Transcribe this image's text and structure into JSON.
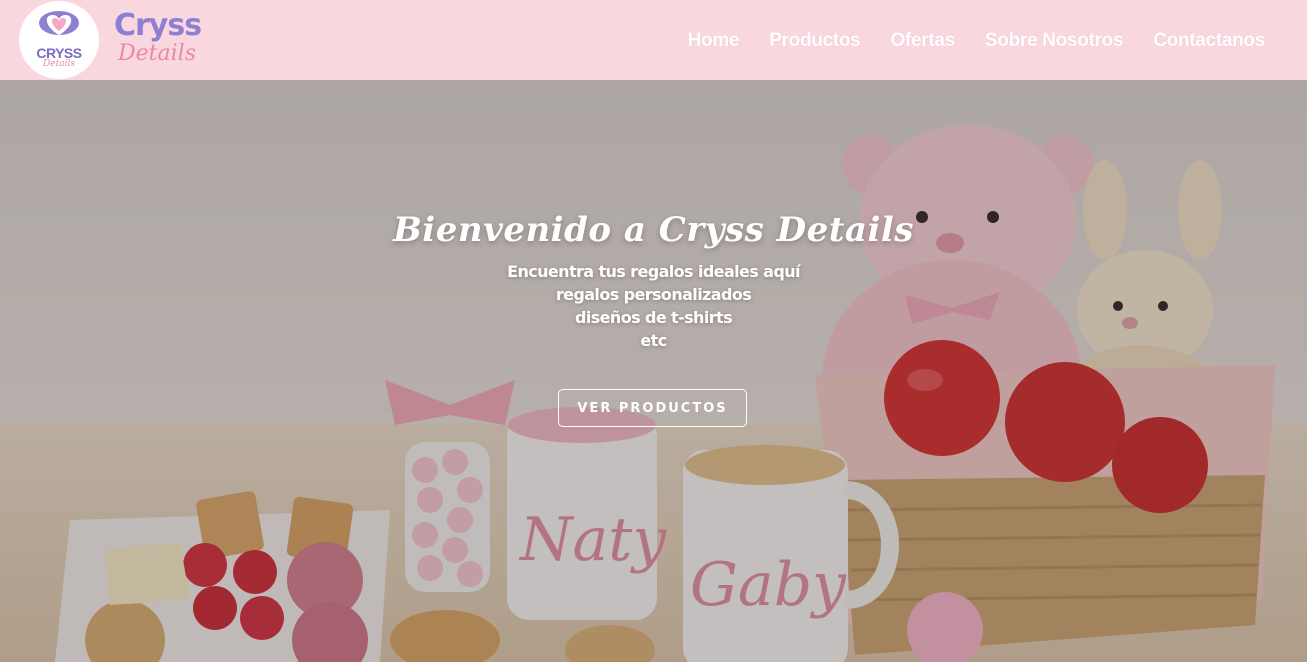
{
  "brand": {
    "logo_badge_name": "CRYSS",
    "logo_badge_sub": "Details",
    "name": "Cryss",
    "tagline": "Details",
    "colors": {
      "header_bg": "#f9d7df",
      "purple": "#8f7fd2",
      "pink": "#ee86a9"
    }
  },
  "nav": {
    "items": [
      {
        "label": "Home"
      },
      {
        "label": "Productos"
      },
      {
        "label": "Ofertas"
      },
      {
        "label": "Sobre Nosotros"
      },
      {
        "label": "Contactanos"
      }
    ]
  },
  "hero": {
    "title": "Bienvenido a Cryss Details",
    "lines": [
      "Encuentra tus regalos ideales aquí",
      "regalos personalizados",
      "diseños de t-shirts",
      "etc"
    ],
    "cta_label": "VER PRODUCTOS",
    "image": {
      "description_icon": "gift-basket-photo",
      "mug_names": [
        "Naty",
        "Gaby"
      ]
    }
  }
}
